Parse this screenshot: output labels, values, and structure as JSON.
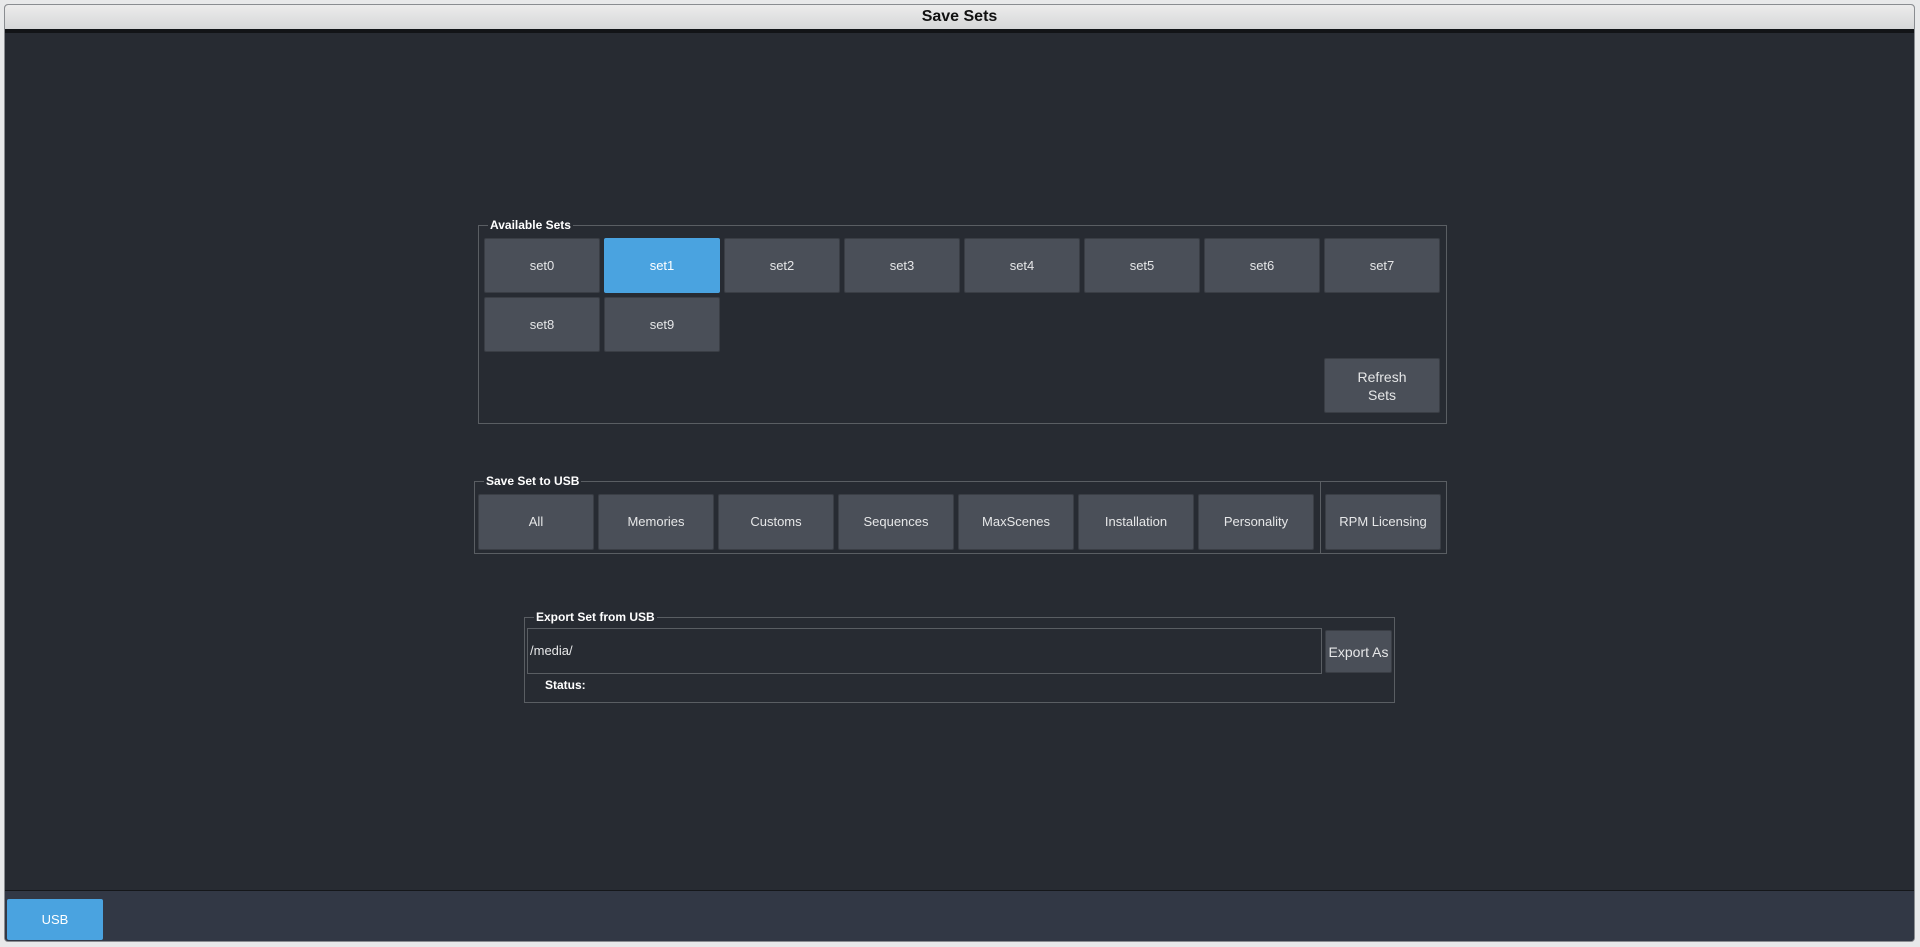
{
  "window": {
    "title": "Save Sets"
  },
  "available_sets": {
    "legend": "Available Sets",
    "sets": [
      "set0",
      "set1",
      "set2",
      "set3",
      "set4",
      "set5",
      "set6",
      "set7",
      "set8",
      "set9"
    ],
    "selected": "set1",
    "refresh_label": "Refresh\nSets"
  },
  "save_set_to_usb": {
    "legend": "Save Set to USB",
    "buttons": [
      "All",
      "Memories",
      "Customs",
      "Sequences",
      "MaxScenes",
      "Installation",
      "Personality"
    ],
    "rpm_label": "RPM Licensing"
  },
  "export_set": {
    "legend": "Export Set from USB",
    "path_value": "/media/",
    "export_label": "Export As",
    "status_label": "Status:"
  },
  "bottom_bar": {
    "usb_label": "USB"
  },
  "colors": {
    "accent": "#4aa3e0",
    "background": "#272b32",
    "button": "#4a4f58"
  }
}
